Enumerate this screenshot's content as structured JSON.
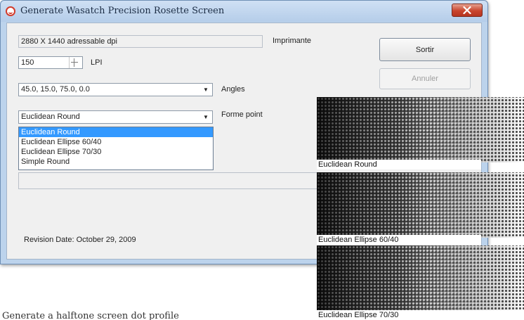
{
  "window": {
    "title": "Generate Wasatch Precision Rosette Screen",
    "close_icon": "close-x-icon"
  },
  "form": {
    "printer_value": "2880 X 1440 adressable dpi",
    "printer_label": "Imprimante",
    "lpi_value": "150",
    "lpi_label": "LPI",
    "angles_value": "45.0, 15.0, 75.0, 0.0",
    "angles_label": "Angles",
    "shape_value": "Euclidean Round",
    "shape_label": "Forme point",
    "shape_options": [
      "Euclidean Round",
      "Euclidean Ellipse 60/40",
      "Euclidean Ellipse 70/30",
      "Simple Round"
    ],
    "shape_selected_index": 0,
    "revision": "Revision Date: October 29, 2009"
  },
  "buttons": {
    "exit": "Sortir",
    "cancel": "Annuler"
  },
  "panels": [
    {
      "label": "Euclidean Round"
    },
    {
      "label": "Euclidean Ellipse 60/40"
    },
    {
      "label": "Euclidean Ellipse 70/30"
    }
  ],
  "colors": {
    "title_bar": "#bcd3ec",
    "close_button": "#c9452d",
    "list_selection": "#3399ff"
  },
  "caption": "Generate a halftone screen dot profile"
}
